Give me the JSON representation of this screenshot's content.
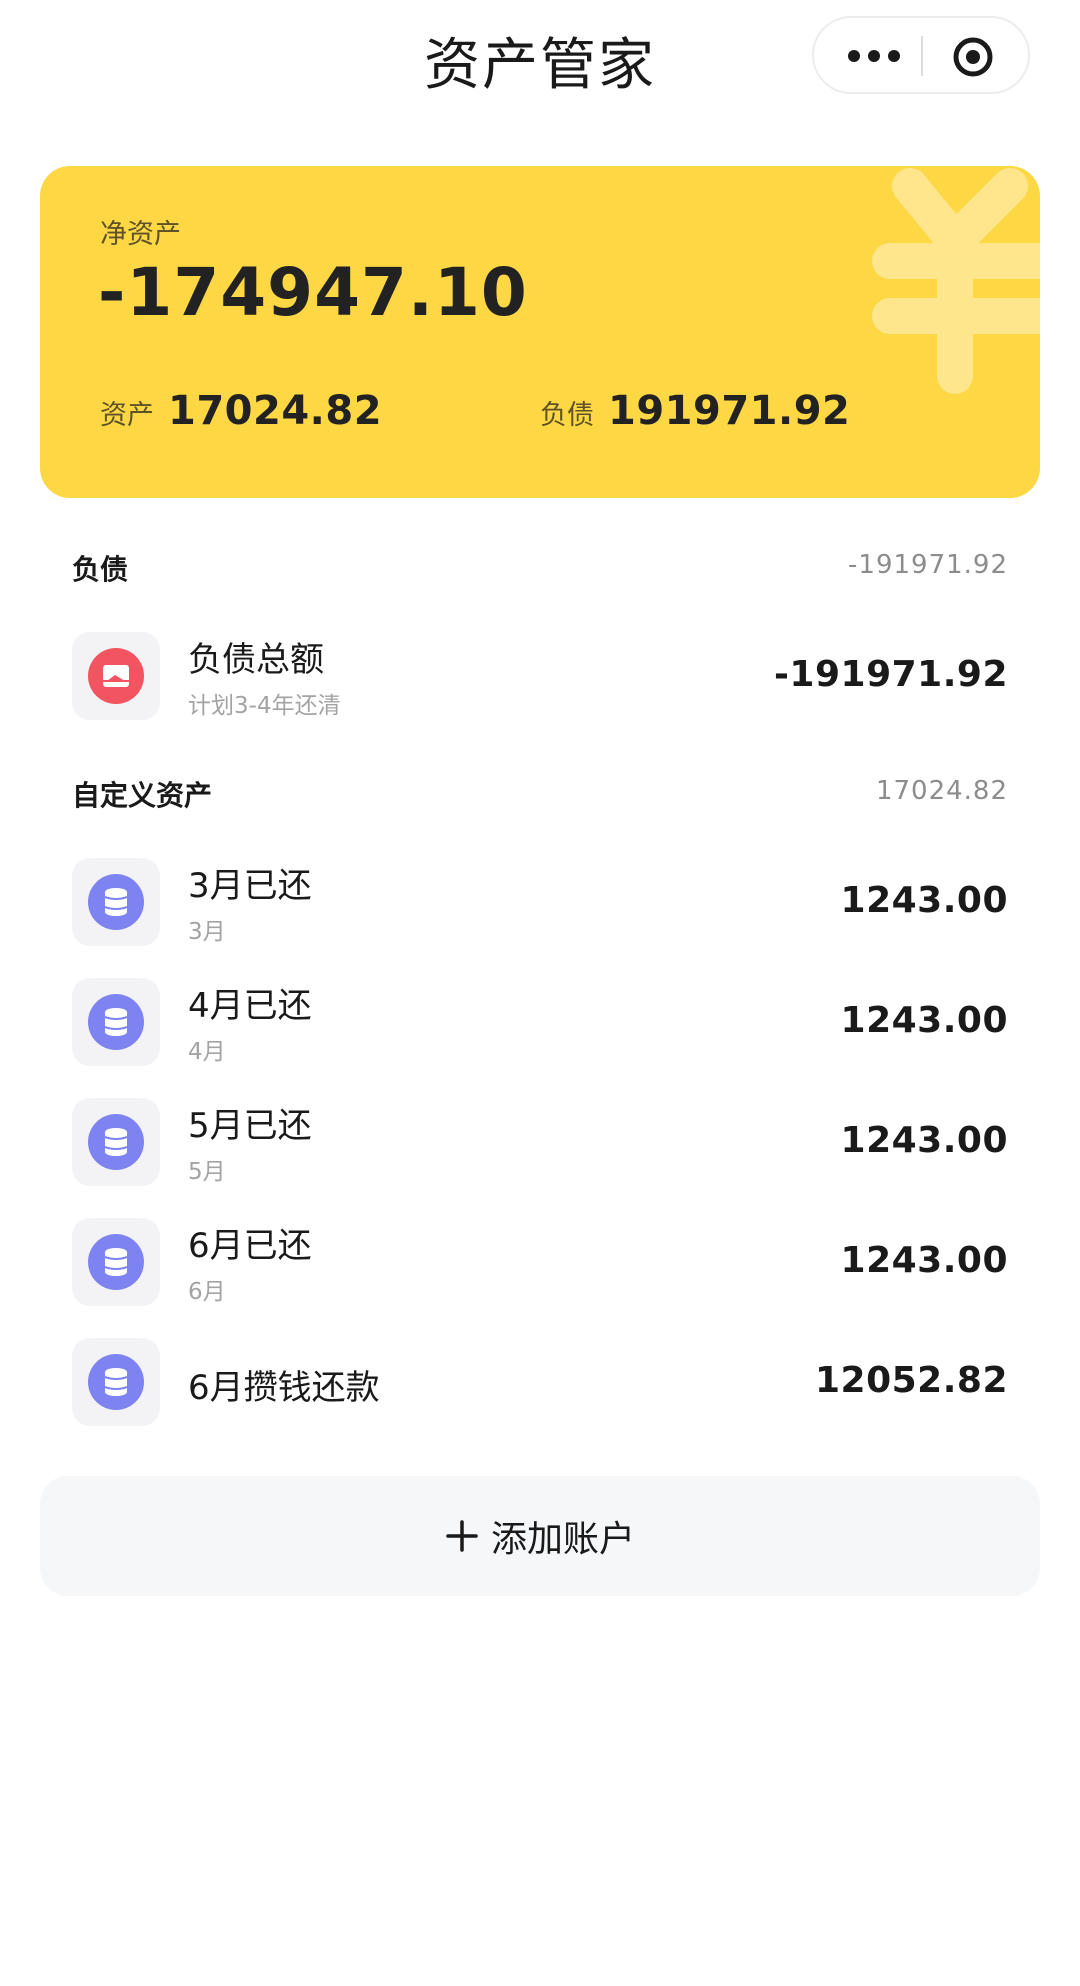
{
  "nav": {
    "title": "资产管家"
  },
  "summary": {
    "net_label": "净资产",
    "net_value": "-174947.10",
    "assets_label": "资产",
    "assets_value": "17024.82",
    "liabilities_label": "负债",
    "liabilities_value": "191971.92"
  },
  "liabilities_section": {
    "title": "负债",
    "total": "-191971.92",
    "items": [
      {
        "title": "负债总额",
        "subtitle": "计划3-4年还清",
        "amount": "-191971.92",
        "icon": "debt-card-icon"
      }
    ]
  },
  "custom_section": {
    "title": "自定义资产",
    "total": "17024.82",
    "items": [
      {
        "title": "3月已还",
        "subtitle": "3月",
        "amount": "1243.00",
        "icon": "coins-icon"
      },
      {
        "title": "4月已还",
        "subtitle": "4月",
        "amount": "1243.00",
        "icon": "coins-icon"
      },
      {
        "title": "5月已还",
        "subtitle": "5月",
        "amount": "1243.00",
        "icon": "coins-icon"
      },
      {
        "title": "6月已还",
        "subtitle": "6月",
        "amount": "1243.00",
        "icon": "coins-icon"
      },
      {
        "title": "6月攒钱还款",
        "subtitle": "",
        "amount": "12052.82",
        "icon": "coins-icon"
      }
    ]
  },
  "add_account": {
    "label": "添加账户"
  },
  "colors": {
    "card_yellow": "#fdd744",
    "debt_red": "#f25561",
    "asset_purple": "#7e83f2",
    "muted_gray": "#8c8c8c"
  }
}
